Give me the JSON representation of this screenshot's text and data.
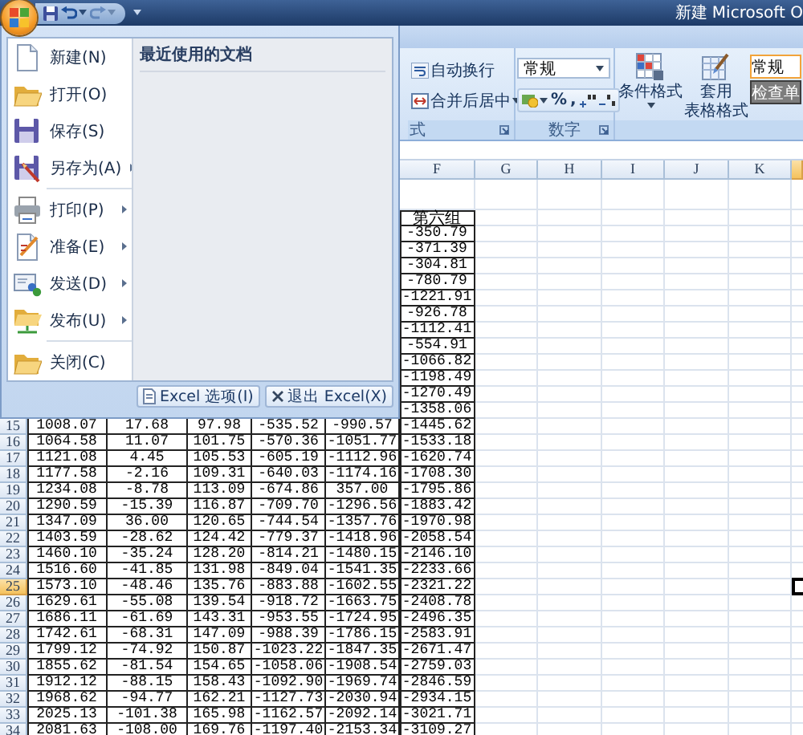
{
  "title_bar": {
    "title": "新建 Microsoft O",
    "quick_access": [
      {
        "kind": "save",
        "dropdown": false,
        "disabled": false
      },
      {
        "kind": "undo",
        "dropdown": true,
        "disabled": false
      },
      {
        "kind": "redo",
        "dropdown": true,
        "disabled": true
      }
    ]
  },
  "ribbon": {
    "alignment": {
      "label": "式",
      "buttons": [
        {
          "kind": "wrap",
          "label": "自动换行",
          "dropdown": false
        },
        {
          "kind": "merge",
          "label": "合并后居中",
          "dropdown": true
        }
      ]
    },
    "number": {
      "label": "数字",
      "format": "常规",
      "tools": [
        {
          "kind": "currency",
          "dropdown": true
        },
        {
          "kind": "text",
          "label": "%"
        },
        {
          "kind": "text",
          "label": ","
        },
        {
          "kind": "increase_decimal"
        },
        {
          "kind": "decrease_decimal"
        }
      ]
    },
    "styles": {
      "conditional_format": "条件格式",
      "table_format": [
        "套用",
        "表格格式"
      ],
      "cell_styles": [
        {
          "kind": "normal",
          "label": "常规"
        },
        {
          "kind": "check",
          "label": "检查单"
        }
      ]
    }
  },
  "office_menu": {
    "recent_title": "最近使用的文档",
    "items": [
      {
        "kind": "new",
        "label": "新建(N)",
        "submenu": false,
        "separator_before": false
      },
      {
        "kind": "open",
        "label": "打开(O)",
        "submenu": false,
        "separator_before": false
      },
      {
        "kind": "save",
        "label": "保存(S)",
        "submenu": false,
        "separator_before": false
      },
      {
        "kind": "save_as",
        "label": "另存为(A)",
        "submenu": true,
        "separator_before": false
      },
      {
        "kind": "print",
        "label": "打印(P)",
        "submenu": true,
        "separator_before": true
      },
      {
        "kind": "prepare",
        "label": "准备(E)",
        "submenu": true,
        "separator_before": false
      },
      {
        "kind": "send",
        "label": "发送(D)",
        "submenu": true,
        "separator_before": false
      },
      {
        "kind": "publish",
        "label": "发布(U)",
        "submenu": true,
        "separator_before": false
      },
      {
        "kind": "close",
        "label": "关闭(C)",
        "submenu": false,
        "separator_before": true
      }
    ],
    "buttons": [
      {
        "kind": "options",
        "label": "Excel 选项(I)"
      },
      {
        "kind": "exit",
        "label": "退出 Excel(X)"
      }
    ]
  },
  "sheet": {
    "column_headers": [
      {
        "label": "F",
        "selected": false
      },
      {
        "label": "G",
        "selected": false
      },
      {
        "label": "H",
        "selected": false
      },
      {
        "label": "I",
        "selected": false
      },
      {
        "label": "J",
        "selected": false
      },
      {
        "label": "K",
        "selected": false
      }
    ],
    "column_f": [
      "第六组",
      "-350.79",
      "-371.39",
      "-304.81",
      "-780.79",
      "-1221.91",
      "-926.78",
      "-1112.41",
      "-554.91",
      "-1066.82",
      "-1198.49",
      "-1270.49",
      "-1358.06"
    ],
    "rows": [
      {
        "number": "15",
        "selected": false,
        "cells": [
          "1008.07",
          "17.68",
          "97.98",
          "-535.52",
          "-990.57",
          "-1445.62"
        ]
      },
      {
        "number": "16",
        "selected": false,
        "cells": [
          "1064.58",
          "11.07",
          "101.75",
          "-570.36",
          "-1051.77",
          "-1533.18"
        ]
      },
      {
        "number": "17",
        "selected": false,
        "cells": [
          "1121.08",
          "4.45",
          "105.53",
          "-605.19",
          "-1112.96",
          "-1620.74"
        ]
      },
      {
        "number": "18",
        "selected": false,
        "cells": [
          "1177.58",
          "-2.16",
          "109.31",
          "-640.03",
          "-1174.16",
          "-1708.30"
        ]
      },
      {
        "number": "19",
        "selected": false,
        "cells": [
          "1234.08",
          "-8.78",
          "113.09",
          "-674.86",
          "357.00",
          "-1795.86"
        ]
      },
      {
        "number": "20",
        "selected": false,
        "cells": [
          "1290.59",
          "-15.39",
          "116.87",
          "-709.70",
          "-1296.56",
          "-1883.42"
        ]
      },
      {
        "number": "21",
        "selected": false,
        "cells": [
          "1347.09",
          "36.00",
          "120.65",
          "-744.54",
          "-1357.76",
          "-1970.98"
        ]
      },
      {
        "number": "22",
        "selected": false,
        "cells": [
          "1403.59",
          "-28.62",
          "124.42",
          "-779.37",
          "-1418.96",
          "-2058.54"
        ]
      },
      {
        "number": "23",
        "selected": false,
        "cells": [
          "1460.10",
          "-35.24",
          "128.20",
          "-814.21",
          "-1480.15",
          "-2146.10"
        ]
      },
      {
        "number": "24",
        "selected": false,
        "cells": [
          "1516.60",
          "-41.85",
          "131.98",
          "-849.04",
          "-1541.35",
          "-2233.66"
        ]
      },
      {
        "number": "25",
        "selected": true,
        "cells": [
          "1573.10",
          "-48.46",
          "135.76",
          "-883.88",
          "-1602.55",
          "-2321.22"
        ]
      },
      {
        "number": "26",
        "selected": false,
        "cells": [
          "1629.61",
          "-55.08",
          "139.54",
          "-918.72",
          "-1663.75",
          "-2408.78"
        ]
      },
      {
        "number": "27",
        "selected": false,
        "cells": [
          "1686.11",
          "-61.69",
          "143.31",
          "-953.55",
          "-1724.95",
          "-2496.35"
        ]
      },
      {
        "number": "28",
        "selected": false,
        "cells": [
          "1742.61",
          "-68.31",
          "147.09",
          "-988.39",
          "-1786.15",
          "-2583.91"
        ]
      },
      {
        "number": "29",
        "selected": false,
        "cells": [
          "1799.12",
          "-74.92",
          "150.87",
          "-1023.22",
          "-1847.35",
          "-2671.47"
        ]
      },
      {
        "number": "30",
        "selected": false,
        "cells": [
          "1855.62",
          "-81.54",
          "154.65",
          "-1058.06",
          "-1908.54",
          "-2759.03"
        ]
      },
      {
        "number": "31",
        "selected": false,
        "cells": [
          "1912.12",
          "-88.15",
          "158.43",
          "-1092.90",
          "-1969.74",
          "-2846.59"
        ]
      },
      {
        "number": "32",
        "selected": false,
        "cells": [
          "1968.62",
          "-94.77",
          "162.21",
          "-1127.73",
          "-2030.94",
          "-2934.15"
        ]
      },
      {
        "number": "33",
        "selected": false,
        "cells": [
          "2025.13",
          "-101.38",
          "165.98",
          "-1162.57",
          "-2092.14",
          "-3021.71"
        ]
      },
      {
        "number": "34",
        "selected": false,
        "cells": [
          "2081.63",
          "-108.00",
          "169.76",
          "-1197.40",
          "-2153.34",
          "-3109.27"
        ]
      }
    ]
  }
}
